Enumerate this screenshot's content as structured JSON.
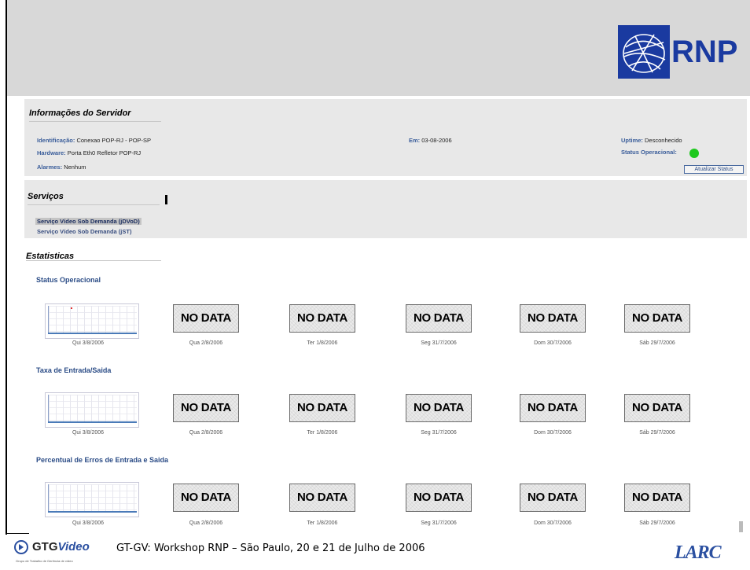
{
  "logo": {
    "text": "RNP",
    "icon": "rnp-globe-icon"
  },
  "server_info": {
    "title": "Informações do Servidor",
    "identificacao_label": "Identificação:",
    "identificacao_value": "Conexao POP-RJ - POP-SP",
    "hardware_label": "Hardware:",
    "hardware_value": "Porta Eth0 Refletor POP-RJ",
    "alarmes_label": "Alarmes:",
    "alarmes_value": "Nenhum",
    "em_label": "Em:",
    "em_value": "03-08-2006",
    "uptime_label": "Uptime:",
    "uptime_value": "Desconhecido",
    "status_label": "Status Operacional:",
    "status_color": "#1ec81e",
    "refresh_button": "Atualizar Status"
  },
  "services": {
    "title": "Serviços",
    "items": [
      {
        "label": "Serviço Vídeo Sob Demanda (jDVoD)",
        "selected": true
      },
      {
        "label": "Serviço Vídeo Sob Demanda (jST)",
        "selected": false
      }
    ]
  },
  "stats": {
    "title": "Estatisticas",
    "no_data_text": "NO DATA",
    "dates": [
      "Qui 3/8/2006",
      "Qua 2/8/2006",
      "Ter 1/8/2006",
      "Seg 31/7/2006",
      "Dom 30/7/2006",
      "Sáb 29/7/2006"
    ],
    "sections": [
      {
        "title": "Status Operacional"
      },
      {
        "title": "Taxa de Entrada/Saida"
      },
      {
        "title": "Percentual de Erros de Entrada e Saida"
      }
    ]
  },
  "footer": {
    "text": "GT-GV: Workshop RNP – São Paulo, 20 e 21 de Julho de 2006",
    "gtg_logo_a": "GTG",
    "gtg_logo_b": "Video",
    "gtg_sub": "Grupo de Trabalho de Gerência de vídeo",
    "larc_logo": "LARC"
  }
}
